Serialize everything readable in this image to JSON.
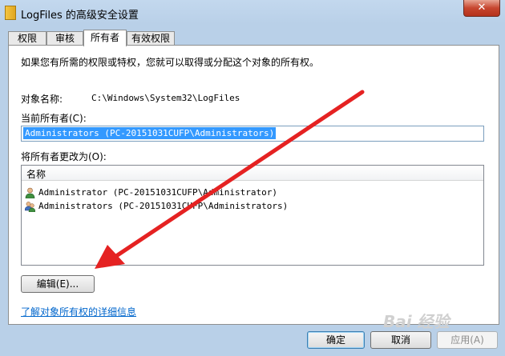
{
  "window": {
    "title": "LogFiles 的高级安全设置",
    "close_glyph": "✕"
  },
  "tabs": [
    {
      "label": "权限"
    },
    {
      "label": "审核"
    },
    {
      "label": "所有者",
      "active": true
    },
    {
      "label": "有效权限"
    }
  ],
  "panel": {
    "intro": "如果您有所需的权限或特权，您就可以取得或分配这个对象的所有权。",
    "object_name_label": "对象名称:",
    "object_name_value": "C:\\Windows\\System32\\LogFiles",
    "current_owner_label": "当前所有者(C):",
    "current_owner_value": "Administrators (PC-20151031CUFP\\Administrators)",
    "change_owner_label": "将所有者更改为(O):",
    "list_header": "名称",
    "list_items": [
      {
        "icon": "user-icon",
        "label": "Administrator (PC-20151031CUFP\\Administrator)"
      },
      {
        "icon": "users-group-icon",
        "label": "Administrators (PC-20151031CUFP\\Administrators)"
      }
    ],
    "edit_button": "编辑(E)...",
    "learn_more_link": "了解对象所有权的详细信息"
  },
  "footer": {
    "ok": "确定",
    "cancel": "取消",
    "apply": "应用(A)"
  },
  "watermark": "Bai 经验",
  "colors": {
    "accent": "#3399ff",
    "arrow": "#e52222",
    "link": "#0066cc"
  }
}
